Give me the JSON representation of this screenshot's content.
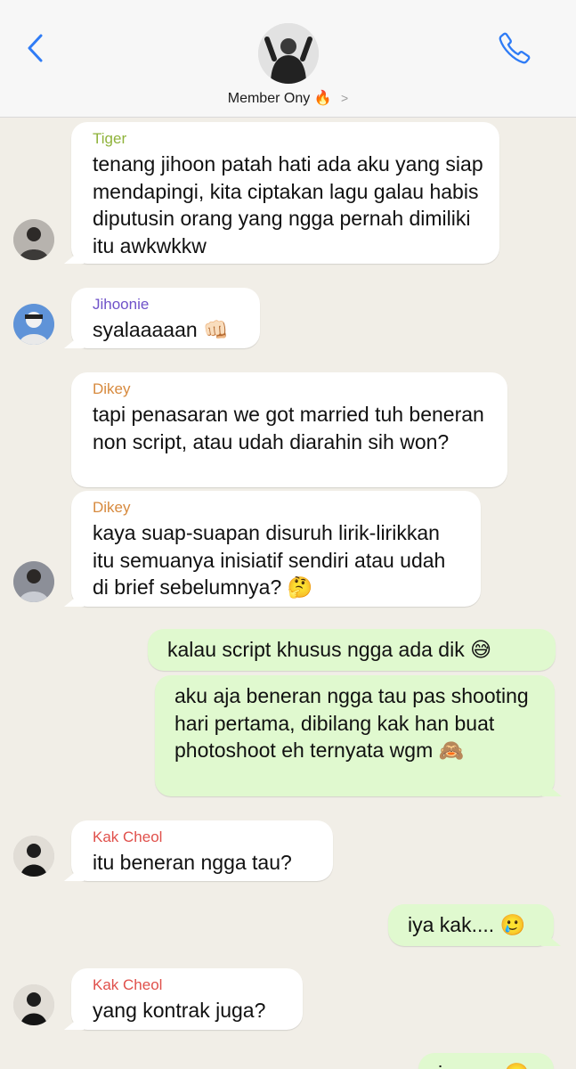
{
  "header": {
    "contact_name": "Member Ony",
    "contact_emoji": "🔥",
    "back_icon": "chevron-left-icon",
    "call_icon": "phone-icon",
    "accent": "#2f7cf6"
  },
  "messages": [
    {
      "sender": "Tiger",
      "sender_color": "#8fb33b",
      "text": "tenang jihoon patah hati ada aku yang siap mendapingi, kita ciptakan lagu galau habis diputusin orang yang ngga pernah dimiliki itu awkwkkw"
    },
    {
      "sender": "Jihoonie",
      "sender_color": "#6f52c9",
      "text": "syalaaaaan",
      "emoji": "👊🏻"
    },
    {
      "sender": "Dikey",
      "sender_color": "#d78a3e",
      "text": "tapi penasaran we got married tuh beneran non script, atau udah diarahin sih won?"
    },
    {
      "sender": "Dikey",
      "sender_color": "#d78a3e",
      "text": "kaya suap-suapan disuruh lirik-lirikkan itu semuanya inisiatif sendiri atau udah di brief sebelumnya?",
      "emoji": "🤔"
    },
    {
      "text": "kalau script khusus ngga ada dik",
      "emoji": "😅"
    },
    {
      "text": "aku aja beneran ngga tau pas shooting hari pertama, dibilang kak han buat photoshoot eh ternyata wgm",
      "emoji": "🙈"
    },
    {
      "sender": "Kak Cheol",
      "sender_color": "#e0504b",
      "text": "itu beneran ngga tau?"
    },
    {
      "text": "iya kak....",
      "emoji": "🥲"
    },
    {
      "sender": "Kak Cheol",
      "sender_color": "#e0504b",
      "text": "yang kontrak juga?"
    },
    {
      "text": "iyaaaa",
      "emoji": "🥲"
    }
  ]
}
